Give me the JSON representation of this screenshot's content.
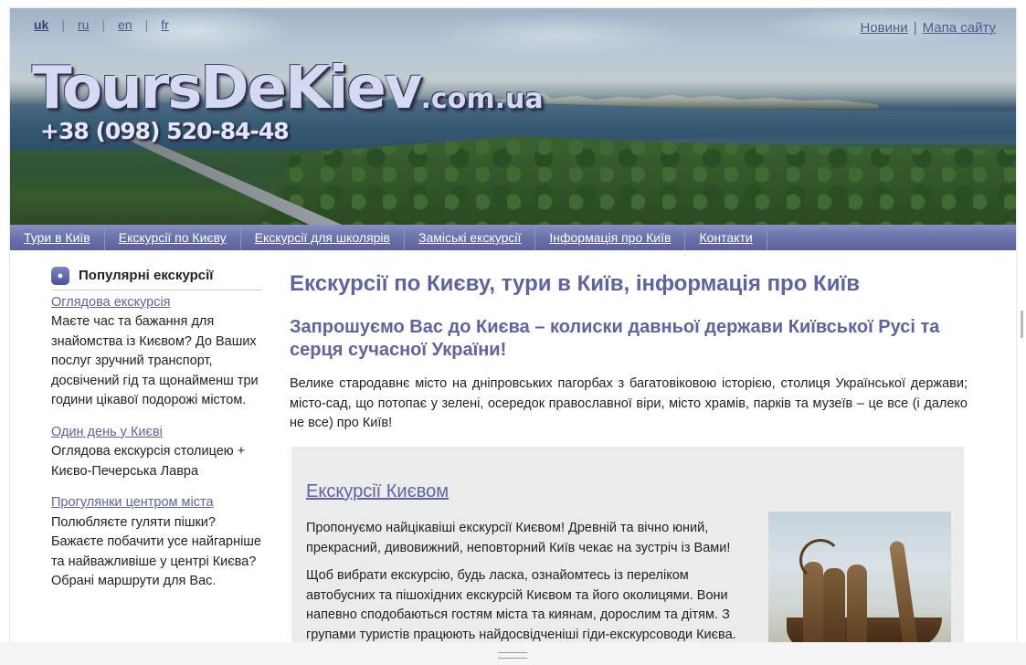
{
  "languages": [
    {
      "code": "uk",
      "active": true
    },
    {
      "code": "ru",
      "active": false
    },
    {
      "code": "en",
      "active": false
    },
    {
      "code": "fr",
      "active": false
    }
  ],
  "toplinks": {
    "news": "Новини",
    "sep": "|",
    "sitemap": "Мапа сайту"
  },
  "logo": {
    "name": "ToursDeKiev",
    "tld": ".com.ua",
    "phone": "+38 (098) 520-84-48"
  },
  "nav": [
    "Тури в Київ",
    "Екскурсії по Києву",
    "Екскурсії для школярів",
    "Заміські екскурсії",
    "Інформація про Київ",
    "Контакти"
  ],
  "sidebar": {
    "title": "Популярні екскурсії",
    "items": [
      {
        "link": "Оглядова екскурсія",
        "text": "Маєте час та бажання для знайомства із Києвом? До Ваших послуг зручний транспорт, досвічений гід та щонайменш три години цікавої подорожі містом."
      },
      {
        "link": "Один день у Києві",
        "text": "Оглядова екскурсія столицею + Києво-Печерська Лавра"
      },
      {
        "link": "Прогулянки центром міста",
        "text": "Полюбляєте гуляти пішки? Бажаєте побачити усе найгарніше та найважливіше у центрі Києва? Обрані маршрути для Вас."
      }
    ]
  },
  "main": {
    "title": "Екскурсії по Києву, тури в Київ, інформація про Київ",
    "subtitle": "Запрошуємо Вас до Києва – колиски давньої держави Київської Русі та серця сучасної України!",
    "intro": "Велике стародавнє місто на дніпровських пагорбах з багатовіковою історією, столиця Української держави; місто-сад, що потопає у зелені, осередок православної віри, місто храмів, парків та музеїв –  це все (і далеко не все) про Київ!",
    "box": {
      "title": "Екскурсії Києвом",
      "p1": "Пропонуємо найцікавіші екскурсії Києвом! Древній та вічно юний, прекрасний, дивовижний, неповторний Київ чекає на зустріч із Вами!",
      "p2": "Щоб вибрати екскурсію, будь ласка, ознайомтесь із переліком автобусних та пішохідних екскурсій Києвом та його околицями. Вони напевно сподобаються гостям міста та киянам, дорослим та дітям. З групами туристів працюють найдосвідченіші гіди-екскурсоводи  Києва."
    }
  }
}
